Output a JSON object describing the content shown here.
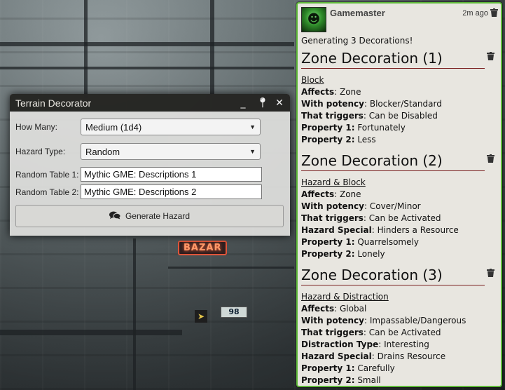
{
  "terrain_window": {
    "title": "Terrain Decorator",
    "fields": {
      "how_many": {
        "label": "How Many:",
        "value": "Medium (1d4)"
      },
      "hazard_type": {
        "label": "Hazard Type:",
        "value": "Random"
      },
      "random_table_1": {
        "label": "Random Table 1:",
        "value": "Mythic GME: Descriptions 1"
      },
      "random_table_2": {
        "label": "Random Table 2:",
        "value": "Mythic GME: Descriptions 2"
      }
    },
    "generate_label": "Generate Hazard"
  },
  "chat": {
    "sender": "Gamemaster",
    "timestamp": "2m ago",
    "intro": "Generating 3 Decorations!",
    "decorations": [
      {
        "title": "Zone Decoration (1)",
        "name": "Block",
        "props": [
          {
            "k": "Affects",
            "v": ": Zone"
          },
          {
            "k": "With potency",
            "v": ": Blocker/Standard"
          },
          {
            "k": "That triggers",
            "v": ": Can be Disabled"
          },
          {
            "k": "Property 1:",
            "v": " Fortunately"
          },
          {
            "k": "Property 2:",
            "v": " Less"
          }
        ]
      },
      {
        "title": "Zone Decoration (2)",
        "name": "Hazard & Block",
        "props": [
          {
            "k": "Affects",
            "v": ": Zone"
          },
          {
            "k": "With potency",
            "v": ": Cover/Minor"
          },
          {
            "k": "That triggers",
            "v": ": Can be Activated"
          },
          {
            "k": "Hazard Special",
            "v": ": Hinders a Resource"
          },
          {
            "k": "Property 1:",
            "v": " Quarrelsomely"
          },
          {
            "k": "Property 2:",
            "v": " Lonely"
          }
        ]
      },
      {
        "title": "Zone Decoration (3)",
        "name": "Hazard & Distraction",
        "props": [
          {
            "k": "Affects",
            "v": ": Global"
          },
          {
            "k": "With potency",
            "v": ": Impassable/Dangerous"
          },
          {
            "k": "That triggers",
            "v": ": Can be Activated"
          },
          {
            "k": "Distraction Type",
            "v": ": Interesting"
          },
          {
            "k": "Hazard Special",
            "v": ": Drains Resource"
          },
          {
            "k": "Property 1:",
            "v": " Carefully"
          },
          {
            "k": "Property 2:",
            "v": " Small"
          }
        ]
      }
    ]
  },
  "background_signs": {
    "bazar": "BAZAR",
    "number": "98"
  },
  "icons": {
    "minimize": "minimize-icon",
    "pin": "pin-icon",
    "close": "close-icon",
    "comments": "comments-icon",
    "trash": "trash-icon"
  },
  "colors": {
    "chat_border": "#5fb93a",
    "section_rule": "#7a1f1f",
    "header_bg": "#141412"
  }
}
